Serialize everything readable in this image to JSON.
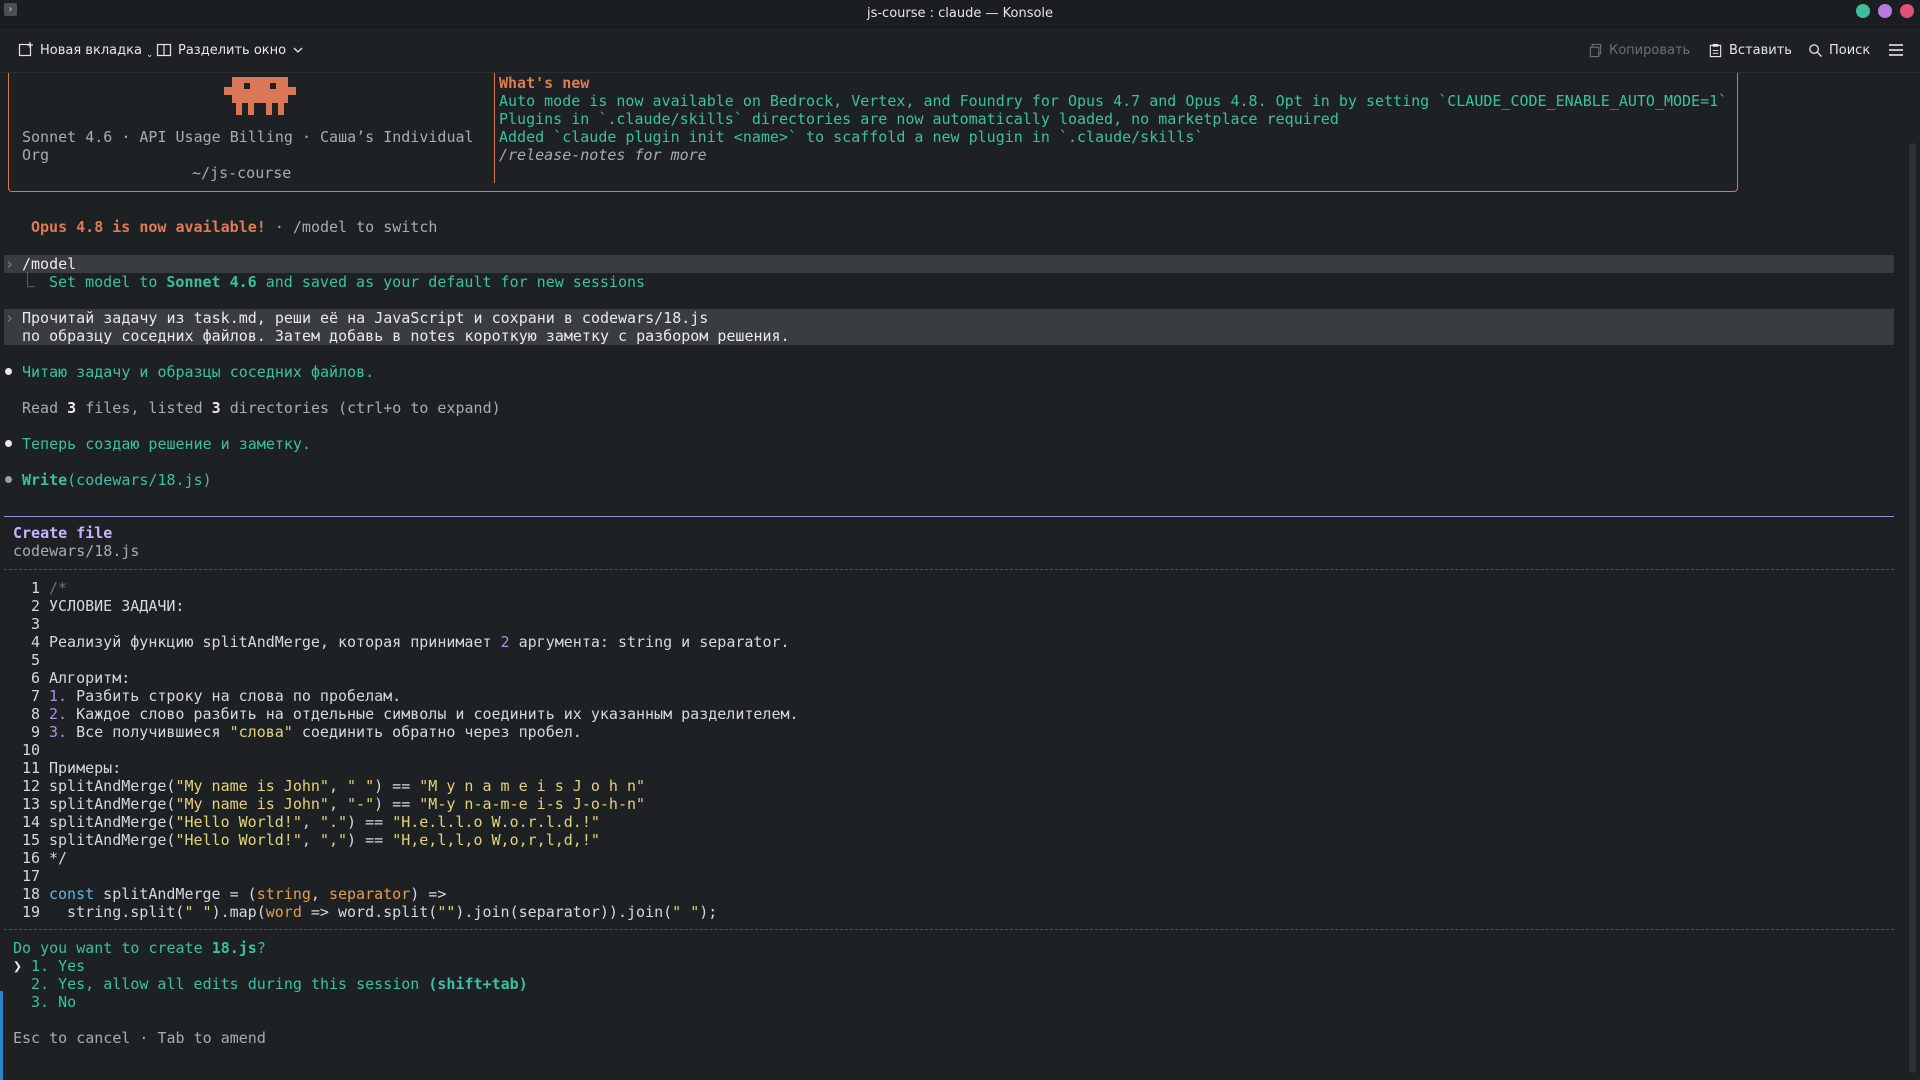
{
  "window": {
    "title": "js-course : claude — Konsole"
  },
  "toolbar": {
    "new_tab": "Новая вкладка",
    "split_view": "Разделить окно",
    "copy": "Копировать",
    "paste": "Вставить",
    "search": "Поиск"
  },
  "welcome": {
    "model_line_1": "Sonnet 4.6 · API Usage Billing · Саша’s Individual",
    "model_line_2": "Org",
    "cwd": "~/js-course",
    "whats_new_title": "What's new",
    "notes": [
      "Auto mode is now available on Bedrock, Vertex, and Foundry for Opus 4.7 and Opus 4.8. Opt in by setting `CLAUDE_CODE_ENABLE_AUTO_MODE=1`",
      "Plugins in `.claude/skills` directories are now automatically loaded, no marketplace required",
      "Added `claude plugin init <name>` to scaffold a new plugin in `.claude/skills`",
      "/release-notes for more"
    ]
  },
  "announce": {
    "highlight": "Opus 4.8 is now available!",
    "rest": " · /model to switch"
  },
  "model_cmd": {
    "command": "/model",
    "result_prefix": "Set model to ",
    "result_model": "Sonnet 4.6",
    "result_suffix": " and saved as your default for new sessions"
  },
  "user_prompt": {
    "line1": "Прочитай задачу из task.md, реши её на JavaScript и сохрани в codewars/18.js",
    "line2": "по образцу соседних файлов. Затем добавь в notes короткую заметку с разбором решения."
  },
  "steps": {
    "reading": "Читаю задачу и образцы соседних файлов.",
    "read_summary": {
      "a": "Read ",
      "n1": "3",
      "b": " files, listed ",
      "n2": "3",
      "c": " directories (ctrl+o to expand)"
    },
    "creating": "Теперь создаю решение и заметку.",
    "write_tool": "Write",
    "write_arg": "(codewars/18.js)"
  },
  "create_file": {
    "title": "Create file",
    "path": "codewars/18.js",
    "line_numbers": [
      "1",
      "2",
      "3",
      "4",
      "5",
      "6",
      "7",
      "8",
      "9",
      "10",
      "11",
      "12",
      "13",
      "14",
      "15",
      "16",
      "17",
      "18",
      "19"
    ]
  },
  "code": {
    "l1": "/*",
    "l2": "УСЛОВИЕ ЗАДАЧИ:",
    "l4a": "Реализуй функцию splitAndMerge, которая принимает ",
    "l4n": "2",
    "l4b": " аргумента: string и separator.",
    "l6": "Алгоритм:",
    "l7n": "1.",
    "l7": " Разбить строку на слова по пробелам.",
    "l8n": "2.",
    "l8": " Каждое слово разбить на отдельные символы и соединить их указанным разделителем.",
    "l9n": "3.",
    "l9a": " Все получившиеся ",
    "l9s": "\"слова\"",
    "l9b": " соединить обратно через пробел.",
    "l11": "Примеры:",
    "ex": [
      {
        "fn": "splitAndMerge(",
        "a1": "\"My name is John\"",
        "sep": ", ",
        "a2": "\" \"",
        "eq": ") == ",
        "r": "\"M y n a m e i s J o h n\""
      },
      {
        "fn": "splitAndMerge(",
        "a1": "\"My name is John\"",
        "sep": ", ",
        "a2": "\"-\"",
        "eq": ") == ",
        "r": "\"M-y n-a-m-e i-s J-o-h-n\""
      },
      {
        "fn": "splitAndMerge(",
        "a1": "\"Hello World!\"",
        "sep": ", ",
        "a2": "\".\"",
        "eq": ") == ",
        "r": "\"H.e.l.l.o W.o.r.l.d.!\""
      },
      {
        "fn": "splitAndMerge(",
        "a1": "\"Hello World!\"",
        "sep": ", ",
        "a2": "\",\"",
        "eq": ") == ",
        "r": "\"H,e,l,l,o W,o,r,l,d,!\""
      }
    ],
    "l16": "*/",
    "l18kw": "const",
    "l18a": " splitAndMerge = (",
    "l18p1": "string",
    "l18c": ", ",
    "l18p2": "separator",
    "l18b": ") =>",
    "l19a": "  string.split(",
    "l19s1": "\" \"",
    "l19b": ").map(",
    "l19p": "word",
    "l19c": " => word.split(",
    "l19s2": "\"\"",
    "l19d": ").join(separator)).join(",
    "l19s3": "\" \"",
    "l19e": ");"
  },
  "confirm": {
    "question_a": "Do you want to create ",
    "question_file": "18.js",
    "question_b": "?",
    "cursor": "❯",
    "opt1": "1. Yes",
    "opt2a": "2. Yes, allow all edits during this session ",
    "opt2b": "(shift+tab)",
    "opt3": "3. No",
    "footer": "Esc to cancel · Tab to amend"
  },
  "colors": {
    "background": "#1e2124",
    "accent_orange": "#e07b53",
    "accent_teal": "#3ac0a4",
    "accent_purple": "#c7b6ff"
  }
}
